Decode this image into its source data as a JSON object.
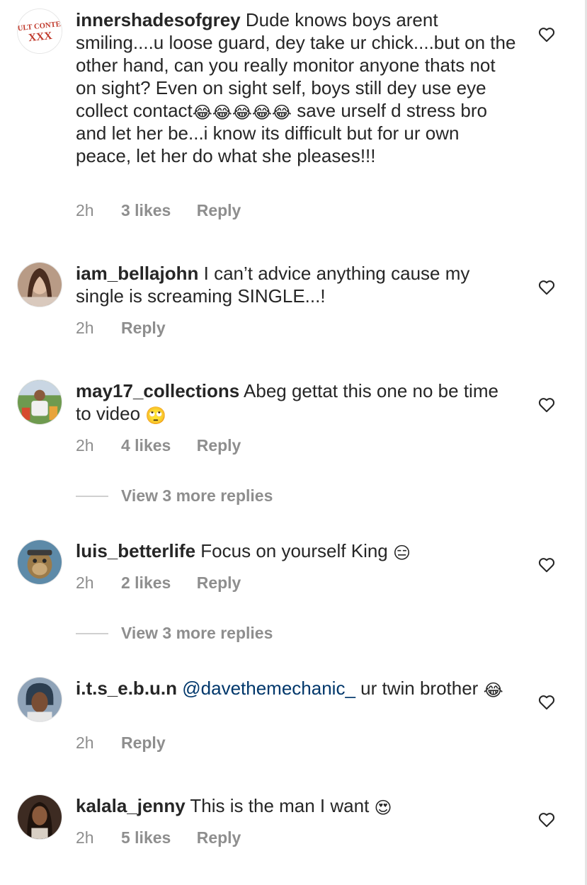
{
  "comments": [
    {
      "username": "innershadesofgrey",
      "text_a": "Dude knows boys arent smiling....u loose guard, dey take ur chick....but on the other hand, can you really monitor anyone thats not on sight? Even on sight self, boys still dey use eye collect contact",
      "emoji_a": "😂😂😂😂😂",
      "text_b": " save urself d stress bro and let her be...i know its difficult but for ur own peace, let her do what she pleases!!!",
      "time": "2h",
      "likes": "3 likes",
      "reply": "Reply",
      "avatar_text": "DULT CONTEN XXX"
    },
    {
      "username": "iam_bellajohn",
      "text_a": "I can’t advice anything cause my single is screaming SINGLE...!",
      "time": "2h",
      "reply": "Reply"
    },
    {
      "username": "may17_collections",
      "text_a": "Abeg gettat this one no be time to video",
      "emoji_a": "🙄",
      "time": "2h",
      "likes": "4 likes",
      "reply": "Reply",
      "view_more": "View 3 more replies"
    },
    {
      "username": "luis_betterlife",
      "text_a": "Focus on yourself King",
      "emoji_a": "😑",
      "time": "2h",
      "likes": "2 likes",
      "reply": "Reply",
      "view_more": "View 3 more replies"
    },
    {
      "username": "i.t.s_e.b.u.n",
      "mention": "@davethemechanic_",
      "text_a": " ur twin brother",
      "emoji_a": "😂",
      "time": "2h",
      "reply": "Reply"
    },
    {
      "username": "kalala_jenny",
      "text_a": "This is the man I want",
      "emoji_a": "😍",
      "time": "2h",
      "likes": "5 likes",
      "reply": "Reply"
    }
  ],
  "icons": {
    "like": "heart-outline-icon"
  },
  "colors": {
    "text": "#262626",
    "meta": "#8e8e8e",
    "mention": "#00376b",
    "divider": "#d0d0d0"
  }
}
